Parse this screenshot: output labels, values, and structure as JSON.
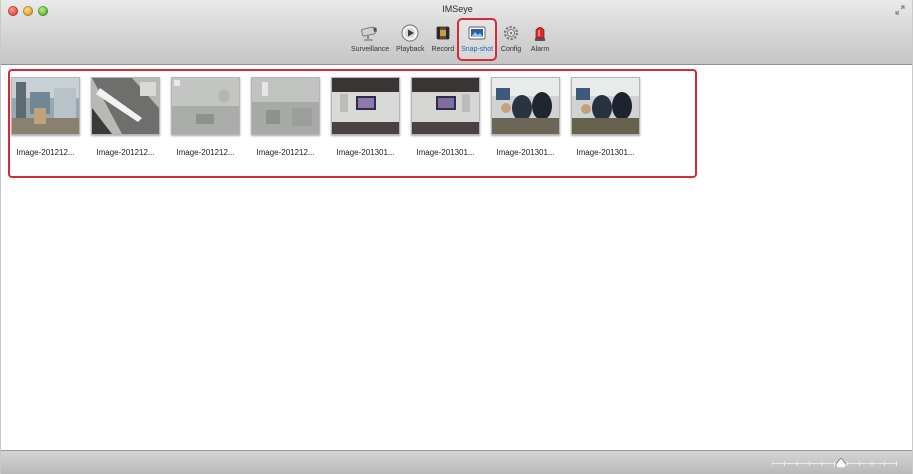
{
  "window": {
    "title": "IMSeye"
  },
  "toolbar": {
    "items": [
      {
        "label": "Surveillance",
        "icon": "surveillance-camera-icon",
        "selected": false
      },
      {
        "label": "Playback",
        "icon": "playback-icon",
        "selected": false
      },
      {
        "label": "Record",
        "icon": "record-icon",
        "selected": false
      },
      {
        "label": "Snap-shot",
        "icon": "snapshot-icon",
        "selected": true
      },
      {
        "label": "Config",
        "icon": "config-gear-icon",
        "selected": false
      },
      {
        "label": "Alarm",
        "icon": "alarm-siren-icon",
        "selected": false
      }
    ]
  },
  "snapshots": [
    {
      "name": "Image-201212..."
    },
    {
      "name": "Image-201212..."
    },
    {
      "name": "Image-201212..."
    },
    {
      "name": "Image-201212..."
    },
    {
      "name": "Image-201301..."
    },
    {
      "name": "Image-201301..."
    },
    {
      "name": "Image-201301..."
    },
    {
      "name": "Image-201301..."
    }
  ],
  "thumbnail_size_slider": {
    "value_fraction": 0.55
  },
  "colors": {
    "highlight": "#d22b3a",
    "selected_label": "#2b63b5"
  }
}
